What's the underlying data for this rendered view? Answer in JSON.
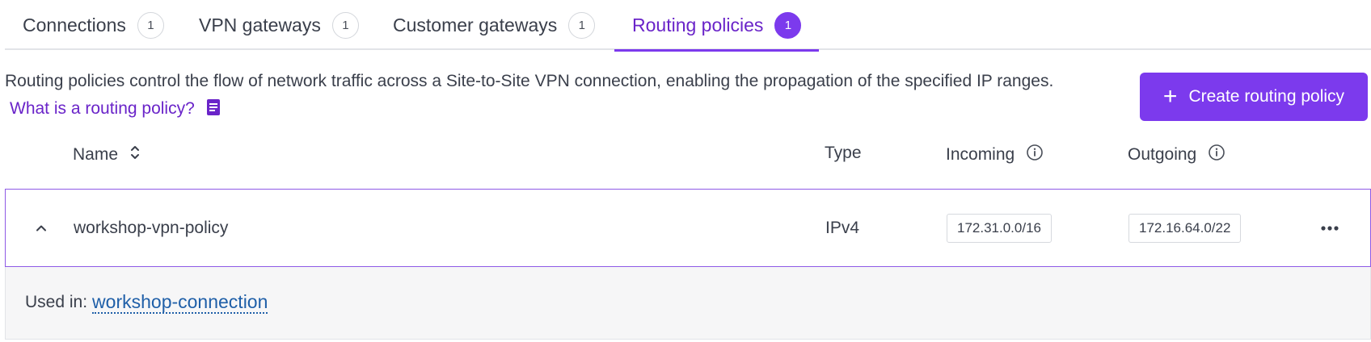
{
  "tabs": [
    {
      "label": "Connections",
      "count": "1",
      "active": false
    },
    {
      "label": "VPN gateways",
      "count": "1",
      "active": false
    },
    {
      "label": "Customer gateways",
      "count": "1",
      "active": false
    },
    {
      "label": "Routing policies",
      "count": "1",
      "active": true
    }
  ],
  "description": {
    "text": "Routing policies control the flow of network traffic across a Site-to-Site VPN connection, enabling the propagation of the specified IP ranges.",
    "help_link": "What is a routing policy?",
    "help_icon": "document-icon"
  },
  "create_button": {
    "label": "Create routing policy",
    "icon": "plus-icon"
  },
  "table": {
    "columns": {
      "name": "Name",
      "type": "Type",
      "incoming": "Incoming",
      "outgoing": "Outgoing"
    },
    "rows": [
      {
        "name": "workshop-vpn-policy",
        "type": "IPv4",
        "incoming": "172.31.0.0/16",
        "outgoing": "172.16.64.0/22",
        "expanded": true,
        "used_in_label": "Used in:",
        "used_in_link": "workshop-connection"
      }
    ]
  },
  "colors": {
    "accent": "#7c3aed",
    "accent_text": "#6a24c9",
    "link": "#1f5fa8",
    "text": "#3a3f4b"
  }
}
